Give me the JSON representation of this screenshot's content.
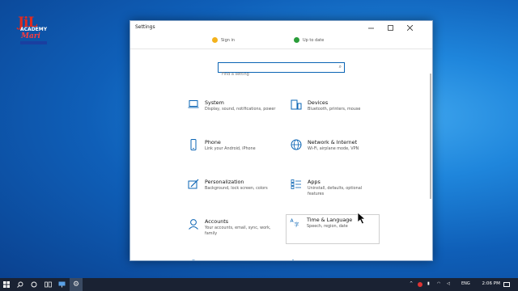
{
  "logo": {
    "line1": "JiL",
    "line2": "ACADEMY",
    "line3": "Mari"
  },
  "window": {
    "title": "Settings"
  },
  "top_strip": {
    "item1": "Sign in",
    "item2": "Up to date"
  },
  "search": {
    "placeholder": "Find a setting"
  },
  "tiles": [
    {
      "name": "System",
      "desc": "Display, sound, notifications, power",
      "icon": "laptop-icon"
    },
    {
      "name": "Devices",
      "desc": "Bluetooth, printers, mouse",
      "icon": "keyboard-printer-icon"
    },
    {
      "name": "Phone",
      "desc": "Link your Android, iPhone",
      "icon": "phone-icon"
    },
    {
      "name": "Network & Internet",
      "desc": "Wi-Fi, airplane mode, VPN",
      "icon": "globe-icon"
    },
    {
      "name": "Personalization",
      "desc": "Background, lock screen, colors",
      "icon": "paint-brush-icon"
    },
    {
      "name": "Apps",
      "desc": "Uninstall, defaults, optional features",
      "icon": "apps-list-icon"
    },
    {
      "name": "Accounts",
      "desc": "Your accounts, email, sync, work, family",
      "icon": "person-icon"
    },
    {
      "name": "Time & Language",
      "desc": "Speech, region, date",
      "icon": "clock-language-icon"
    }
  ],
  "taskbar": {
    "lang": "ENG",
    "time": "2:06 PM"
  },
  "colors": {
    "accent": "#0a64b4",
    "taskbar": "#1a2233"
  }
}
